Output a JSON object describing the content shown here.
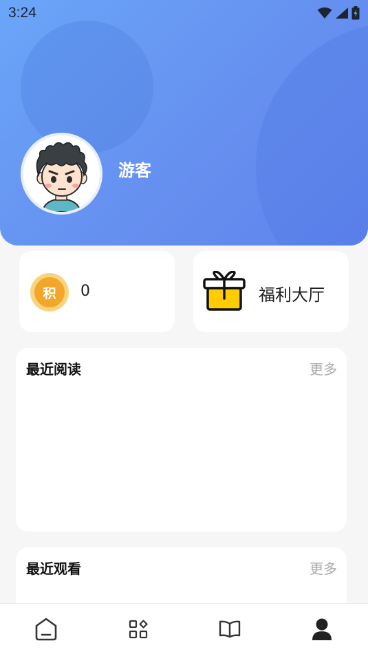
{
  "status_bar": {
    "time": "3:24",
    "icons": [
      "wifi-icon",
      "cellular-signal-icon",
      "battery-icon"
    ]
  },
  "profile": {
    "name": "游客",
    "avatar": "cartoon-boy-avatar"
  },
  "points_card": {
    "badge": "积",
    "value": "0"
  },
  "welfare_card": {
    "icon": "gift-icon",
    "label": "福利大厅"
  },
  "sections": [
    {
      "title": "最近阅读",
      "more": "更多"
    },
    {
      "title": "最近观看",
      "more": "更多"
    }
  ],
  "tabbar": {
    "tabs": [
      {
        "icon": "home-icon",
        "active": false
      },
      {
        "icon": "category-icon",
        "active": false
      },
      {
        "icon": "book-icon",
        "active": false
      },
      {
        "icon": "person-icon",
        "active": true
      }
    ]
  },
  "colors": {
    "header_gradient_start": "#6aa6f8",
    "header_gradient_end": "#5f84ec",
    "coin_gold": "#f2a72a",
    "gift_yellow": "#ffcc00",
    "more_gray": "#a9a9a9"
  }
}
